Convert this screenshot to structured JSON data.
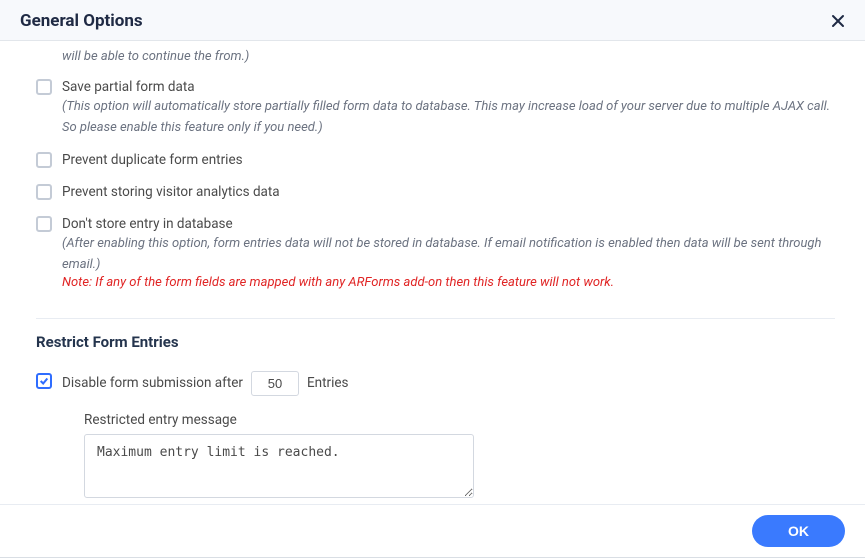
{
  "header": {
    "title": "General Options"
  },
  "options": {
    "orphan_help": "will be able to continue the from.)",
    "save_partial": {
      "label": "Save partial form data",
      "help": "(This option will automatically store partially filled form data to database. This may increase load of your server due to multiple AJAX call. So please enable this feature only if you need.)"
    },
    "prevent_duplicate": {
      "label": "Prevent duplicate form entries"
    },
    "prevent_analytics": {
      "label": "Prevent storing visitor analytics data"
    },
    "dont_store": {
      "label": "Don't store entry in database",
      "help": "(After enabling this option, form entries data will not be stored in database. If email notification is enabled then data will be sent through email.)",
      "warn": "Note: If any of the form fields are mapped with any ARForms add-on then this feature will not work."
    }
  },
  "restrict": {
    "title": "Restrict Form Entries",
    "disable_label": "Disable form submission after",
    "limit_value": "50",
    "suffix": "Entries",
    "msg_label": "Restricted entry message",
    "msg_value": "Maximum entry limit is reached."
  },
  "footer": {
    "ok": "OK"
  }
}
